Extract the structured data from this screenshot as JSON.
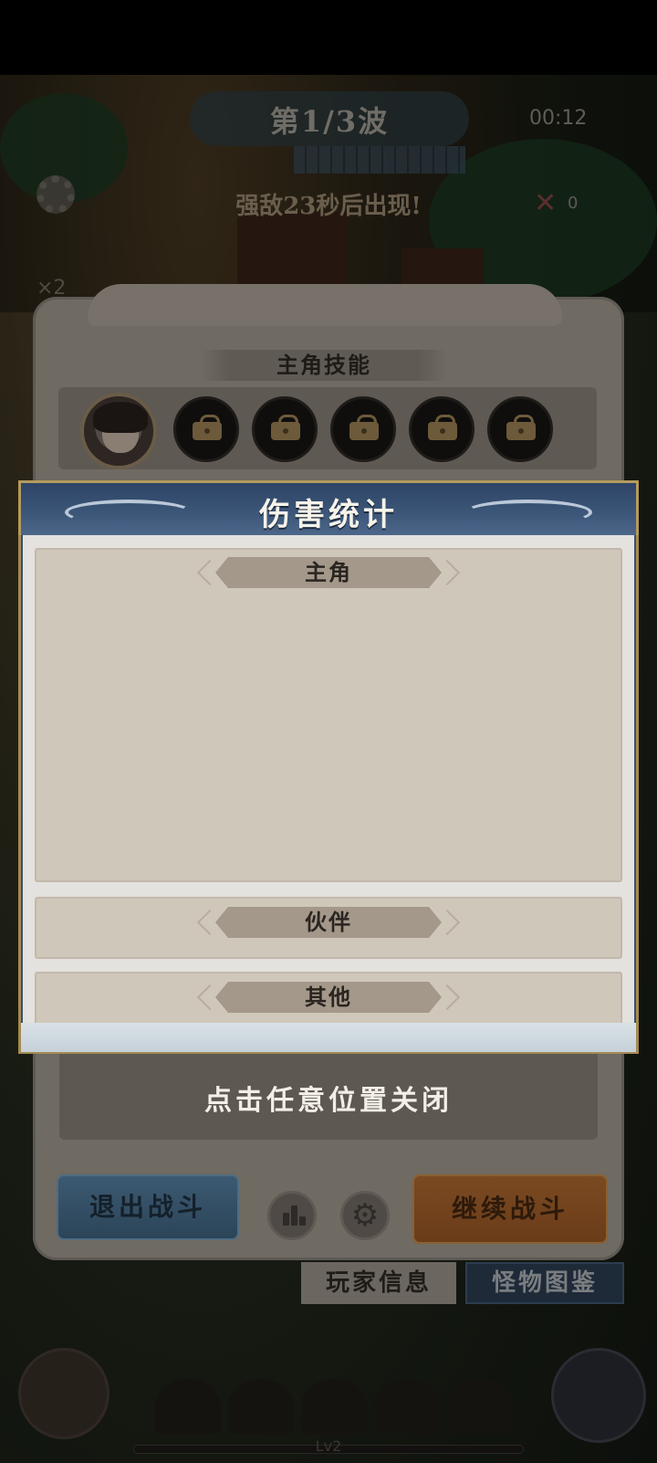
{
  "game_hud": {
    "wave": "第1/3波",
    "timer": "00:12",
    "enemy_notice": "强敌23秒后出现!",
    "kill_count": "0",
    "speed": "×2",
    "level": "Lv2"
  },
  "pause_panel": {
    "skills_title": "主角技能",
    "skill_slots": [
      "locked",
      "locked",
      "locked",
      "locked",
      "locked"
    ],
    "close_hint": "点击任意位置关闭",
    "exit_button": "退出战斗",
    "continue_button": "继续战斗",
    "tabs": {
      "player_info": "玩家信息",
      "monster_codex": "怪物图鉴"
    }
  },
  "damage_modal": {
    "title": "伤害统计",
    "sections": {
      "main_hero": "主角",
      "partner": "伙伴",
      "other": "其他"
    }
  },
  "icons": {
    "settings": "gear-icon",
    "stats": "bar-chart-icon",
    "lock": "lock-icon",
    "kill": "crossed-swords-icon"
  }
}
